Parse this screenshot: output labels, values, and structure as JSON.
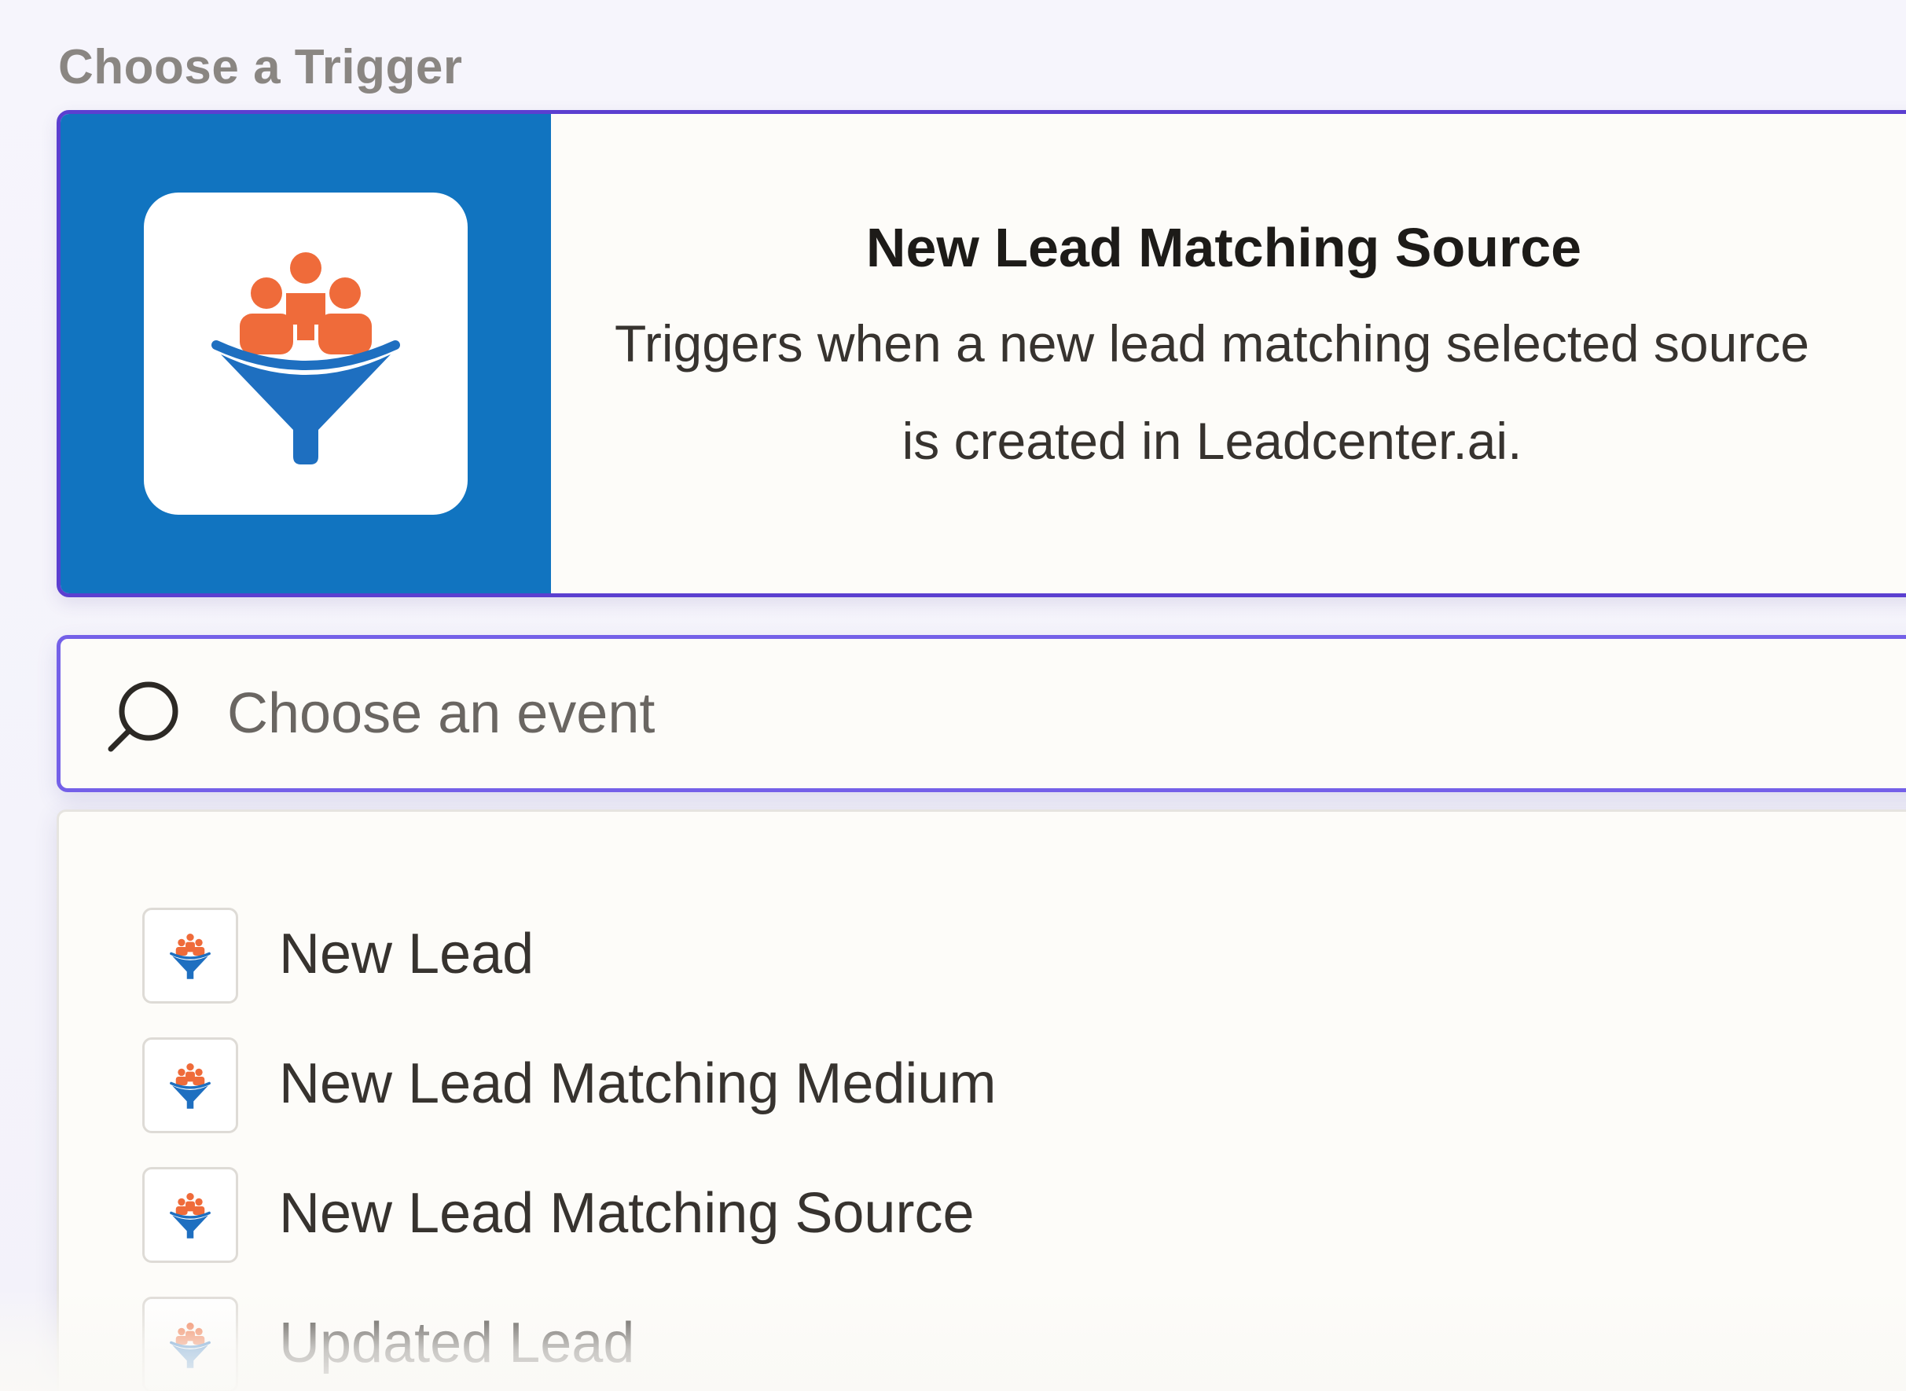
{
  "section": {
    "title": "Choose a Trigger"
  },
  "selected_trigger": {
    "app_icon": "leadcenter-funnel-icon",
    "title": "New Lead Matching Source",
    "description": "Triggers when a new lead matching selected source is created in Leadcenter.ai."
  },
  "search": {
    "icon": "search-icon",
    "placeholder": "Choose an event",
    "value": ""
  },
  "events": [
    {
      "label": "New Lead",
      "icon": "leadcenter-funnel-icon"
    },
    {
      "label": "New Lead Matching Medium",
      "icon": "leadcenter-funnel-icon"
    },
    {
      "label": "New Lead Matching Source",
      "icon": "leadcenter-funnel-icon"
    },
    {
      "label": "Updated Lead",
      "icon": "leadcenter-funnel-icon"
    }
  ],
  "colors": {
    "brand_blue": "#1174c0",
    "funnel_blue": "#1e6fc0",
    "people_orange": "#ef6b3a",
    "accent_purple": "#5b3fd0",
    "focus_purple": "#7460e8"
  }
}
